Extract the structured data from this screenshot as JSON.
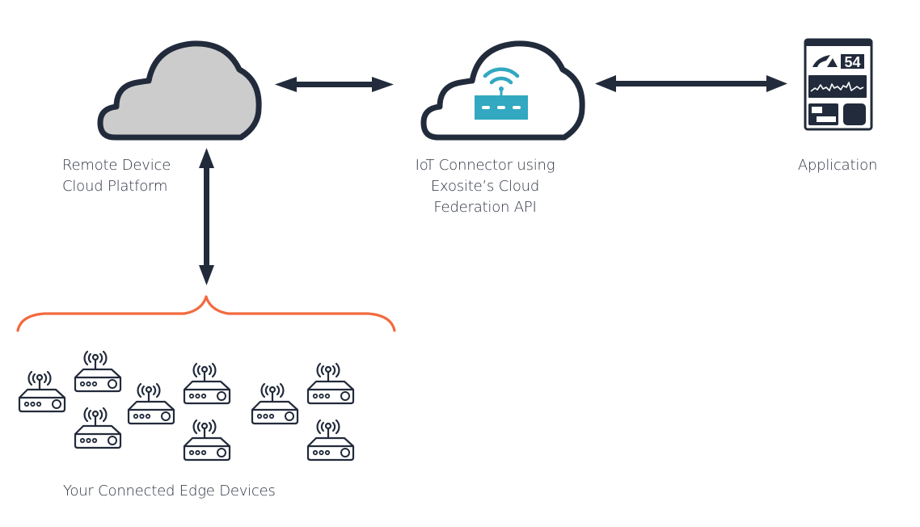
{
  "colors": {
    "outline": "#222b3b",
    "cloud_fill": "#cccccc",
    "connector_accent": "#32a8c1",
    "brace": "#f26a3f",
    "text": "#2b3240"
  },
  "nodes": {
    "remote_platform": {
      "icon": "cloud-icon",
      "label_lines": [
        "Remote Device",
        "Cloud Platform"
      ]
    },
    "iot_connector": {
      "icon": "cloud-router-icon",
      "label_lines": [
        "IoT Connector using",
        "Exosite’s Cloud",
        "Federation API"
      ]
    },
    "application": {
      "icon": "dashboard-icon",
      "label_lines": [
        "Application"
      ],
      "gauge_value": "54"
    },
    "edge_devices": {
      "icon": "router-icon",
      "count": 9,
      "label_lines": [
        "Your Connected Edge Devices"
      ]
    }
  },
  "connections": [
    {
      "from": "remote_platform",
      "to": "iot_connector",
      "type": "bidirectional"
    },
    {
      "from": "iot_connector",
      "to": "application",
      "type": "bidirectional"
    },
    {
      "from": "remote_platform",
      "to": "edge_devices",
      "type": "bidirectional"
    }
  ]
}
